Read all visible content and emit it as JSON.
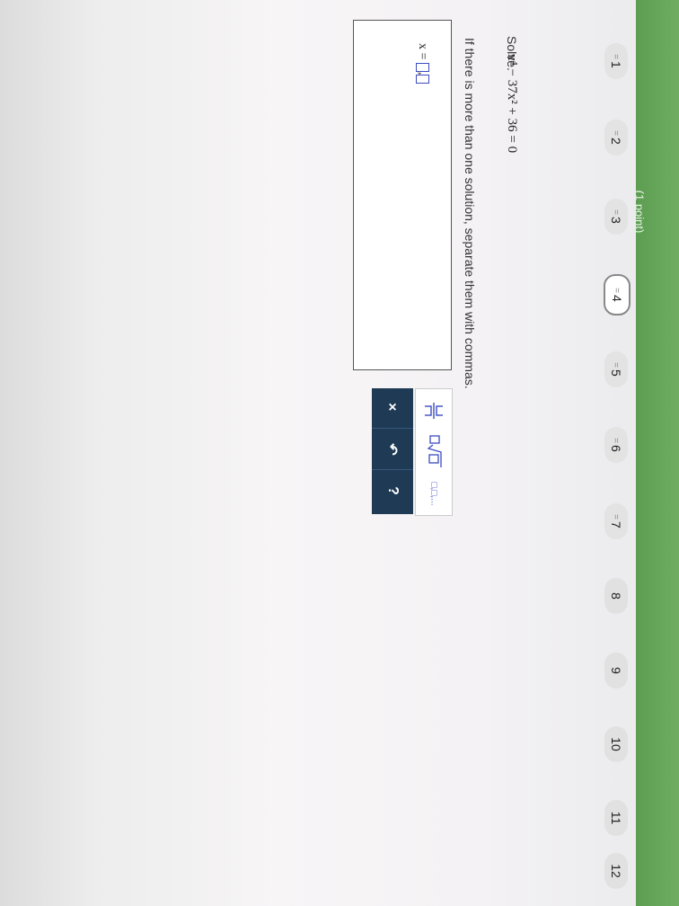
{
  "header": {
    "points_label": "(1 point)"
  },
  "nav": {
    "questions": [
      {
        "label": "1",
        "status": "answered"
      },
      {
        "label": "2",
        "status": "answered"
      },
      {
        "label": "3",
        "status": "answered"
      },
      {
        "label": "4",
        "status": "current"
      },
      {
        "label": "5",
        "status": "answered"
      },
      {
        "label": "6",
        "status": "answered"
      },
      {
        "label": "7",
        "status": "answered"
      },
      {
        "label": "8",
        "status": "unanswered"
      },
      {
        "label": "9",
        "status": "unanswered"
      },
      {
        "label": "10",
        "status": "unanswered"
      },
      {
        "label": "11",
        "status": "unanswered"
      },
      {
        "label": "12",
        "status": "unanswered"
      }
    ],
    "answered_mark": "="
  },
  "question": {
    "prompt": "Solve.",
    "equation": "x⁴ − 37x² + 36 = 0",
    "instruction": "If there is more than one solution, separate them with commas."
  },
  "answer": {
    "prefix": "x =",
    "separator": ","
  },
  "palette": {
    "fraction": "fraction",
    "sqrt": "square root",
    "list": "□,□,..."
  },
  "controls": {
    "clear": "×",
    "undo": "↶",
    "help": "?"
  },
  "colors": {
    "accent_green": "#66a65a",
    "control_bg": "#1e3a55",
    "slot_blue": "#3b4cc0"
  }
}
